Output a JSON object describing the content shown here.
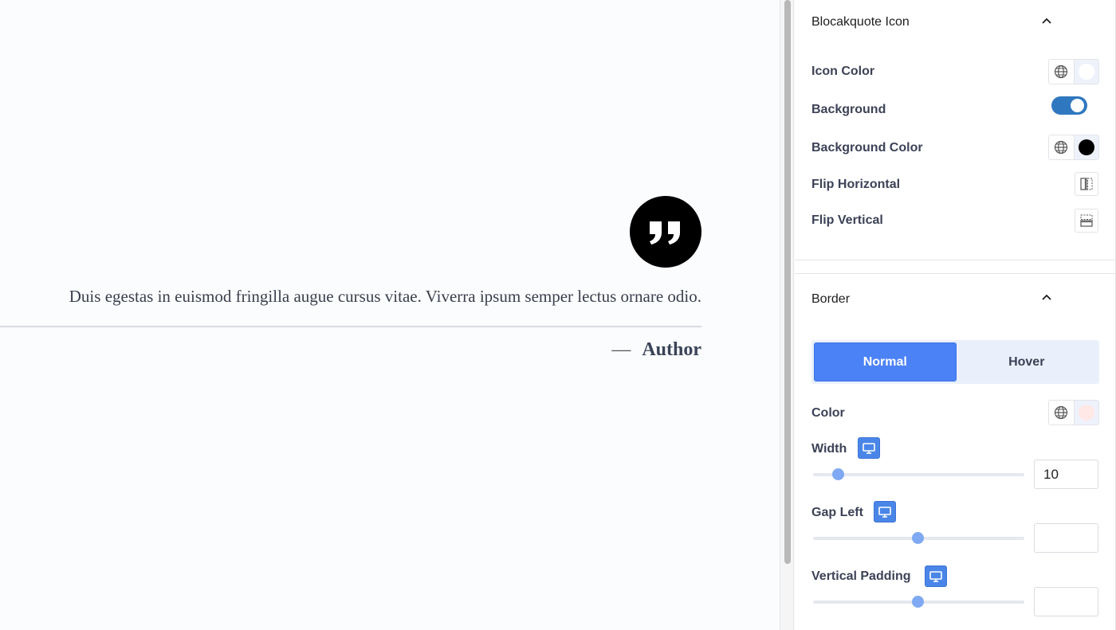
{
  "canvas": {
    "quote_text": "Duis egestas in euismod fringilla augue cursus vitae. Viverra ipsum semper lectus ornare odio.",
    "author_dash": "—",
    "author": "Author",
    "quote_icon": "quote-icon"
  },
  "sidebar": {
    "blockquote_section": {
      "title": "Blocakquote Icon",
      "icon_color_label": "Icon Color",
      "icon_color_value": "#ffffff",
      "background_label": "Background",
      "background_enabled": true,
      "background_color_label": "Background Color",
      "background_color_value": "#000000",
      "flip_horizontal_label": "Flip Horizontal",
      "flip_vertical_label": "Flip Vertical"
    },
    "border_section": {
      "title": "Border",
      "tabs": [
        {
          "label": "Normal",
          "active": true
        },
        {
          "label": "Hover",
          "active": false
        }
      ],
      "color_label": "Color",
      "color_value": "#ffe8e6",
      "width_label": "Width",
      "width_value": "10",
      "gap_left_label": "Gap Left",
      "gap_left_value": "",
      "vertical_padding_label": "Vertical Padding",
      "vertical_padding_value": ""
    }
  },
  "colors": {
    "accent": "#4b82f6",
    "toggle_on": "#2f78c0",
    "slider_thumb": "#7fa9f3"
  }
}
